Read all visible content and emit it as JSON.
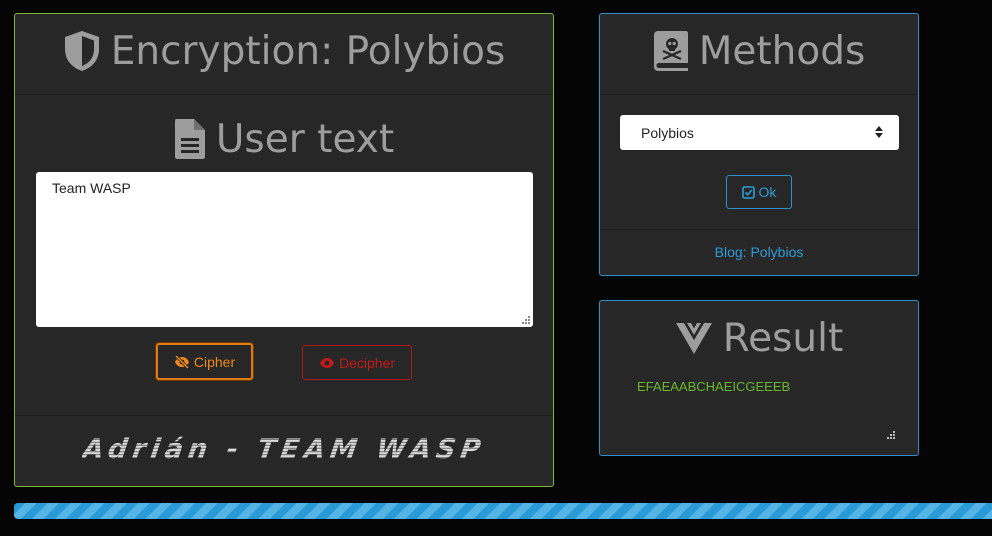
{
  "encryption": {
    "title": "Encryption: Polybios",
    "user_text_title": "User text",
    "user_text_value": "Team WASP",
    "cipher_label": "Cipher",
    "decipher_label": "Decipher",
    "signature": "Adrián - TEAM WASP"
  },
  "methods": {
    "title": "Methods",
    "selected_method": "Polybios",
    "ok_label": "Ok",
    "blog_link": "Blog: Polybios"
  },
  "result": {
    "title": "Result",
    "value": "EFAEAABCHAEICGEEEB"
  },
  "progress": {
    "percent": 100
  },
  "colors": {
    "encryption_border": "#7fb53a",
    "info_border": "#2f8fcb",
    "cipher": "#f08a1a",
    "decipher": "#c21a1a",
    "link": "#2f9bd8",
    "result_text": "#6bb82a"
  },
  "icons": [
    "shield-icon",
    "file-icon",
    "skull-book-icon",
    "eye-slash-icon",
    "eye-icon",
    "check-square-icon",
    "vuejs-icon",
    "select-arrows-icon",
    "resize-grip-icon"
  ]
}
